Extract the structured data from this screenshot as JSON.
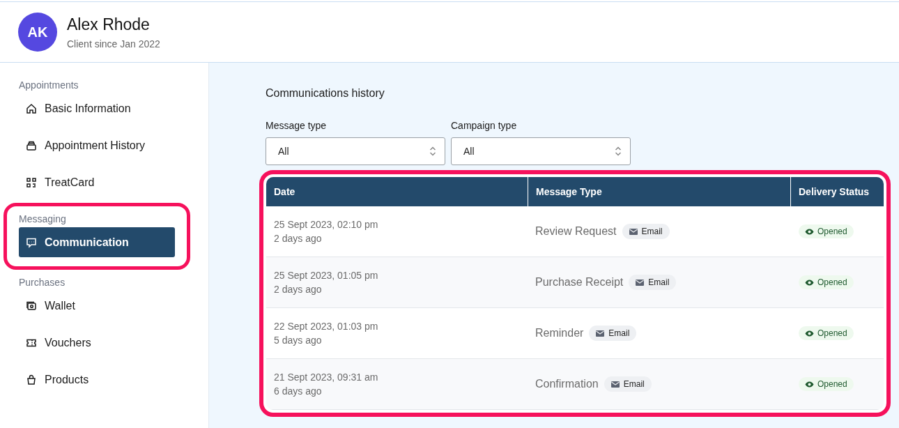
{
  "client": {
    "initials": "AK",
    "name": "Alex Rhode",
    "subtitle": "Client since Jan 2022"
  },
  "sidebar": {
    "sections": [
      {
        "title": "Appointments",
        "highlighted": false,
        "items": [
          {
            "label": "Basic Information",
            "selected": false
          },
          {
            "label": "Appointment History",
            "selected": false
          },
          {
            "label": "TreatCard",
            "selected": false
          }
        ]
      },
      {
        "title": "Messaging",
        "highlighted": true,
        "items": [
          {
            "label": "Communication",
            "selected": true
          }
        ]
      },
      {
        "title": "Purchases",
        "highlighted": false,
        "items": [
          {
            "label": "Wallet",
            "selected": false
          },
          {
            "label": "Vouchers",
            "selected": false
          },
          {
            "label": "Products",
            "selected": false
          }
        ]
      }
    ]
  },
  "main": {
    "title": "Communications history",
    "filters": [
      {
        "label": "Message type",
        "value": "All"
      },
      {
        "label": "Campaign type",
        "value": "All"
      }
    ],
    "table": {
      "highlighted": true,
      "columns": [
        "Date",
        "Message Type",
        "Delivery Status"
      ],
      "rows": [
        {
          "date": "25 Sept 2023, 02:10 pm",
          "ago": "2 days ago",
          "type": "Review Request",
          "channel": "Email",
          "status": "Opened"
        },
        {
          "date": "25 Sept 2023, 01:05 pm",
          "ago": "2 days ago",
          "type": "Purchase Receipt",
          "channel": "Email",
          "status": "Opened"
        },
        {
          "date": "22 Sept 2023, 01:03 pm",
          "ago": "5 days ago",
          "type": "Reminder",
          "channel": "Email",
          "status": "Opened"
        },
        {
          "date": "21 Sept 2023, 09:31 am",
          "ago": "6 days ago",
          "type": "Confirmation",
          "channel": "Email",
          "status": "Opened"
        }
      ]
    }
  }
}
